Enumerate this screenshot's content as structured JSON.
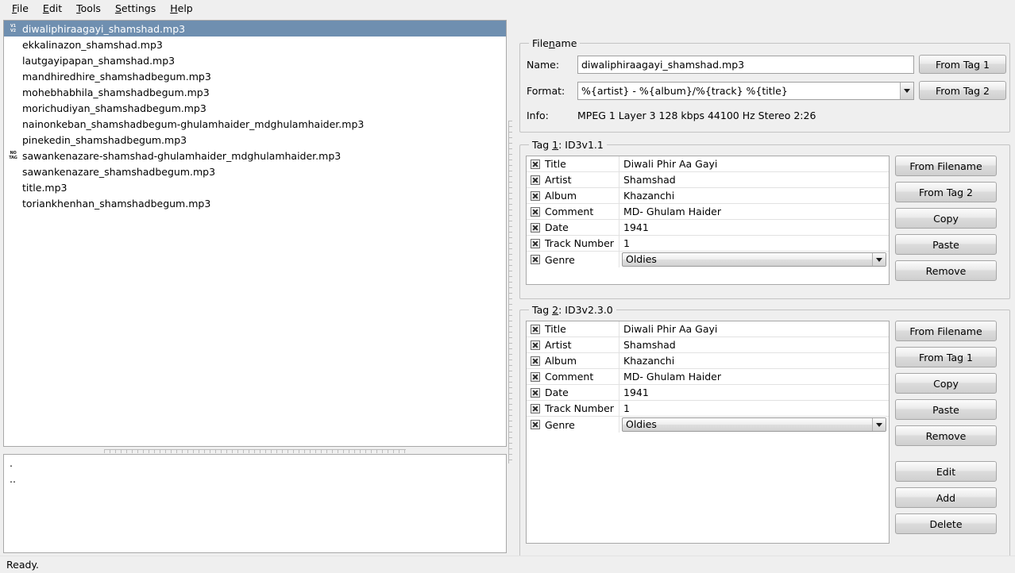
{
  "window": {
    "statusbar_text": "Ready."
  },
  "menubar": {
    "items": [
      {
        "label": "File",
        "mnemonic": "F",
        "rest": "ile"
      },
      {
        "label": "Edit",
        "mnemonic": "E",
        "rest": "dit"
      },
      {
        "label": "Tools",
        "mnemonic": "T",
        "rest": "ools"
      },
      {
        "label": "Settings",
        "mnemonic": "S",
        "rest": "ettings"
      },
      {
        "label": "Help",
        "mnemonic": "H",
        "rest": "elp"
      }
    ]
  },
  "file_list": {
    "items": [
      {
        "name": "diwaliphiraagayi_shamshad.mp3",
        "icon": "tag-v1-v2-icon",
        "icon_line1": "V1",
        "icon_line2": "V2",
        "selected": true
      },
      {
        "name": "ekkalinazon_shamshad.mp3",
        "icon": "none",
        "icon_line1": "",
        "icon_line2": "",
        "selected": false
      },
      {
        "name": "lautgayipapan_shamshad.mp3",
        "icon": "none",
        "icon_line1": "",
        "icon_line2": "",
        "selected": false
      },
      {
        "name": "mandhiredhire_shamshadbegum.mp3",
        "icon": "none",
        "icon_line1": "",
        "icon_line2": "",
        "selected": false
      },
      {
        "name": "mohebhabhila_shamshadbegum.mp3",
        "icon": "none",
        "icon_line1": "",
        "icon_line2": "",
        "selected": false
      },
      {
        "name": "morichudiyan_shamshadbegum.mp3",
        "icon": "none",
        "icon_line1": "",
        "icon_line2": "",
        "selected": false
      },
      {
        "name": "nainonkeban_shamshadbegum-ghulamhaider_mdghulamhaider.mp3",
        "icon": "none",
        "icon_line1": "",
        "icon_line2": "",
        "selected": false
      },
      {
        "name": "pinekedin_shamshadbegum.mp3",
        "icon": "none",
        "icon_line1": "",
        "icon_line2": "",
        "selected": false
      },
      {
        "name": "sawankenazare-shamshad-ghulamhaider_mdghulamhaider.mp3",
        "icon": "tag-none-icon",
        "icon_line1": "NO",
        "icon_line2": "TAG",
        "selected": false
      },
      {
        "name": "sawankenazare_shamshadbegum.mp3",
        "icon": "none",
        "icon_line1": "",
        "icon_line2": "",
        "selected": false
      },
      {
        "name": "title.mp3",
        "icon": "none",
        "icon_line1": "",
        "icon_line2": "",
        "selected": false
      },
      {
        "name": "toriankhenhan_shamshadbegum.mp3",
        "icon": "none",
        "icon_line1": "",
        "icon_line2": "",
        "selected": false
      }
    ]
  },
  "dir_list": {
    "items": [
      {
        "name": "."
      },
      {
        "name": ".."
      }
    ]
  },
  "filename_group": {
    "title_prefix": "File",
    "title_mnemonic": "n",
    "title_suffix": "ame",
    "name_label": "Name:",
    "name_value": "diwaliphiraagayi_shamshad.mp3",
    "format_label": "Format:",
    "format_value": "%{artist} - %{album}/%{track} %{title}",
    "info_label": "Info:",
    "info_value": "MPEG 1 Layer 3 128 kbps 44100 Hz Stereo 2:26",
    "from_tag1_button": "From Tag 1",
    "from_tag2_button": "From Tag 2"
  },
  "tag1": {
    "title_prefix": "Tag ",
    "title_mnemonic": "1",
    "title_suffix": ": ID3v1.1",
    "rows": [
      {
        "field": "Title",
        "value": "Diwali Phir Aa Gayi",
        "checked": true,
        "type": "text"
      },
      {
        "field": "Artist",
        "value": "Shamshad",
        "checked": true,
        "type": "text"
      },
      {
        "field": "Album",
        "value": "Khazanchi",
        "checked": true,
        "type": "text"
      },
      {
        "field": "Comment",
        "value": "MD- Ghulam Haider",
        "checked": true,
        "type": "text"
      },
      {
        "field": "Date",
        "value": "1941",
        "checked": true,
        "type": "text"
      },
      {
        "field": "Track Number",
        "value": "1",
        "checked": true,
        "type": "text"
      },
      {
        "field": "Genre",
        "value": "Oldies",
        "checked": true,
        "type": "combo"
      }
    ],
    "buttons": [
      {
        "label": "From Filename"
      },
      {
        "label": "From Tag 2"
      },
      {
        "label": "Copy"
      },
      {
        "label": "Paste"
      },
      {
        "label": "Remove"
      }
    ]
  },
  "tag2": {
    "title_prefix": "Tag ",
    "title_mnemonic": "2",
    "title_suffix": ": ID3v2.3.0",
    "rows": [
      {
        "field": "Title",
        "value": "Diwali Phir Aa Gayi",
        "checked": true,
        "type": "text"
      },
      {
        "field": "Artist",
        "value": "Shamshad",
        "checked": true,
        "type": "text"
      },
      {
        "field": "Album",
        "value": "Khazanchi",
        "checked": true,
        "type": "text"
      },
      {
        "field": "Comment",
        "value": "MD- Ghulam Haider",
        "checked": true,
        "type": "text"
      },
      {
        "field": "Date",
        "value": "1941",
        "checked": true,
        "type": "text"
      },
      {
        "field": "Track Number",
        "value": "1",
        "checked": true,
        "type": "text"
      },
      {
        "field": "Genre",
        "value": "Oldies",
        "checked": true,
        "type": "combo"
      }
    ],
    "buttons": [
      {
        "label": "From Filename"
      },
      {
        "label": "From Tag 1"
      },
      {
        "label": "Copy"
      },
      {
        "label": "Paste"
      },
      {
        "label": "Remove"
      }
    ],
    "frame_buttons": [
      {
        "label": "Edit"
      },
      {
        "label": "Add"
      },
      {
        "label": "Delete"
      }
    ]
  },
  "colors": {
    "selection_bg": "#6f8fb0",
    "selection_fg": "#ffffff",
    "window_bg": "#efefef",
    "field_bg": "#ffffff"
  }
}
